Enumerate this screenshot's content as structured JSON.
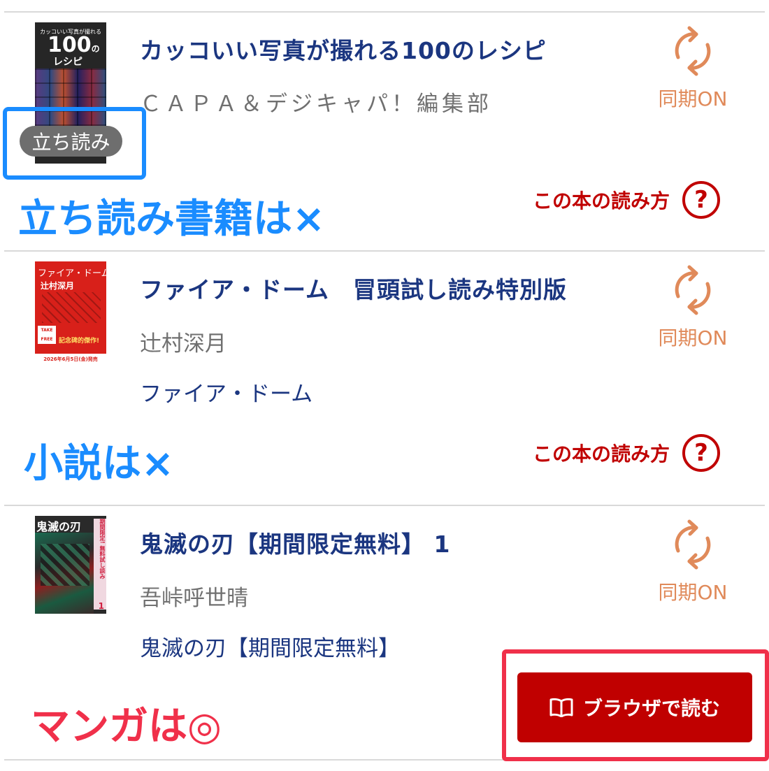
{
  "colors": {
    "title": "#1b3680",
    "author": "#707070",
    "sync": "#e08a5a",
    "howto": "#c00000",
    "annot_blue": "#1a8cff",
    "annot_red": "#f0304a",
    "read_button": "#c00000"
  },
  "books": [
    {
      "title": "カッコいい写真が撮れる100のレシピ",
      "author": "ＣＡＰＡ＆デジキャパ！編集部",
      "cover": {
        "top_text": "カッコいい写真が撮れる",
        "big_number": "100",
        "big_suffix": "の",
        "sub_text": "レシピ"
      },
      "badge": "立ち読み",
      "sync_label": "同期ON",
      "sync_icon": "sync-icon",
      "howto_label": "この本の読み方",
      "howto_icon": "?"
    },
    {
      "title": "ファイア・ドーム　冒頭試し読み特別版",
      "author": "辻村深月",
      "series": "ファイア・ドーム",
      "cover": {
        "top_text": "ファイア・ドーム",
        "author_text": "辻村深月",
        "badge_text": "TAKE FREE",
        "tag_text": "記念碑的傑作!",
        "date_text": "2026年6月5日(金)発売"
      },
      "sync_label": "同期ON",
      "sync_icon": "sync-icon",
      "howto_label": "この本の読み方",
      "howto_icon": "?"
    },
    {
      "title": "鬼滅の刃【期間限定無料】 1",
      "author": "吾峠呼世晴",
      "series": "鬼滅の刃【期間限定無料】",
      "cover": {
        "top_text": "鬼滅の刃",
        "side_text": "期間限定! 無料試し読み",
        "volume": "1"
      },
      "sync_label": "同期ON",
      "sync_icon": "sync-icon",
      "read_button_label": "ブラウザで読む",
      "read_button_icon": "book-icon"
    }
  ],
  "annotations": {
    "first": "立ち読み書籍は×",
    "second": "小説は×",
    "third": "マンガは◎"
  }
}
